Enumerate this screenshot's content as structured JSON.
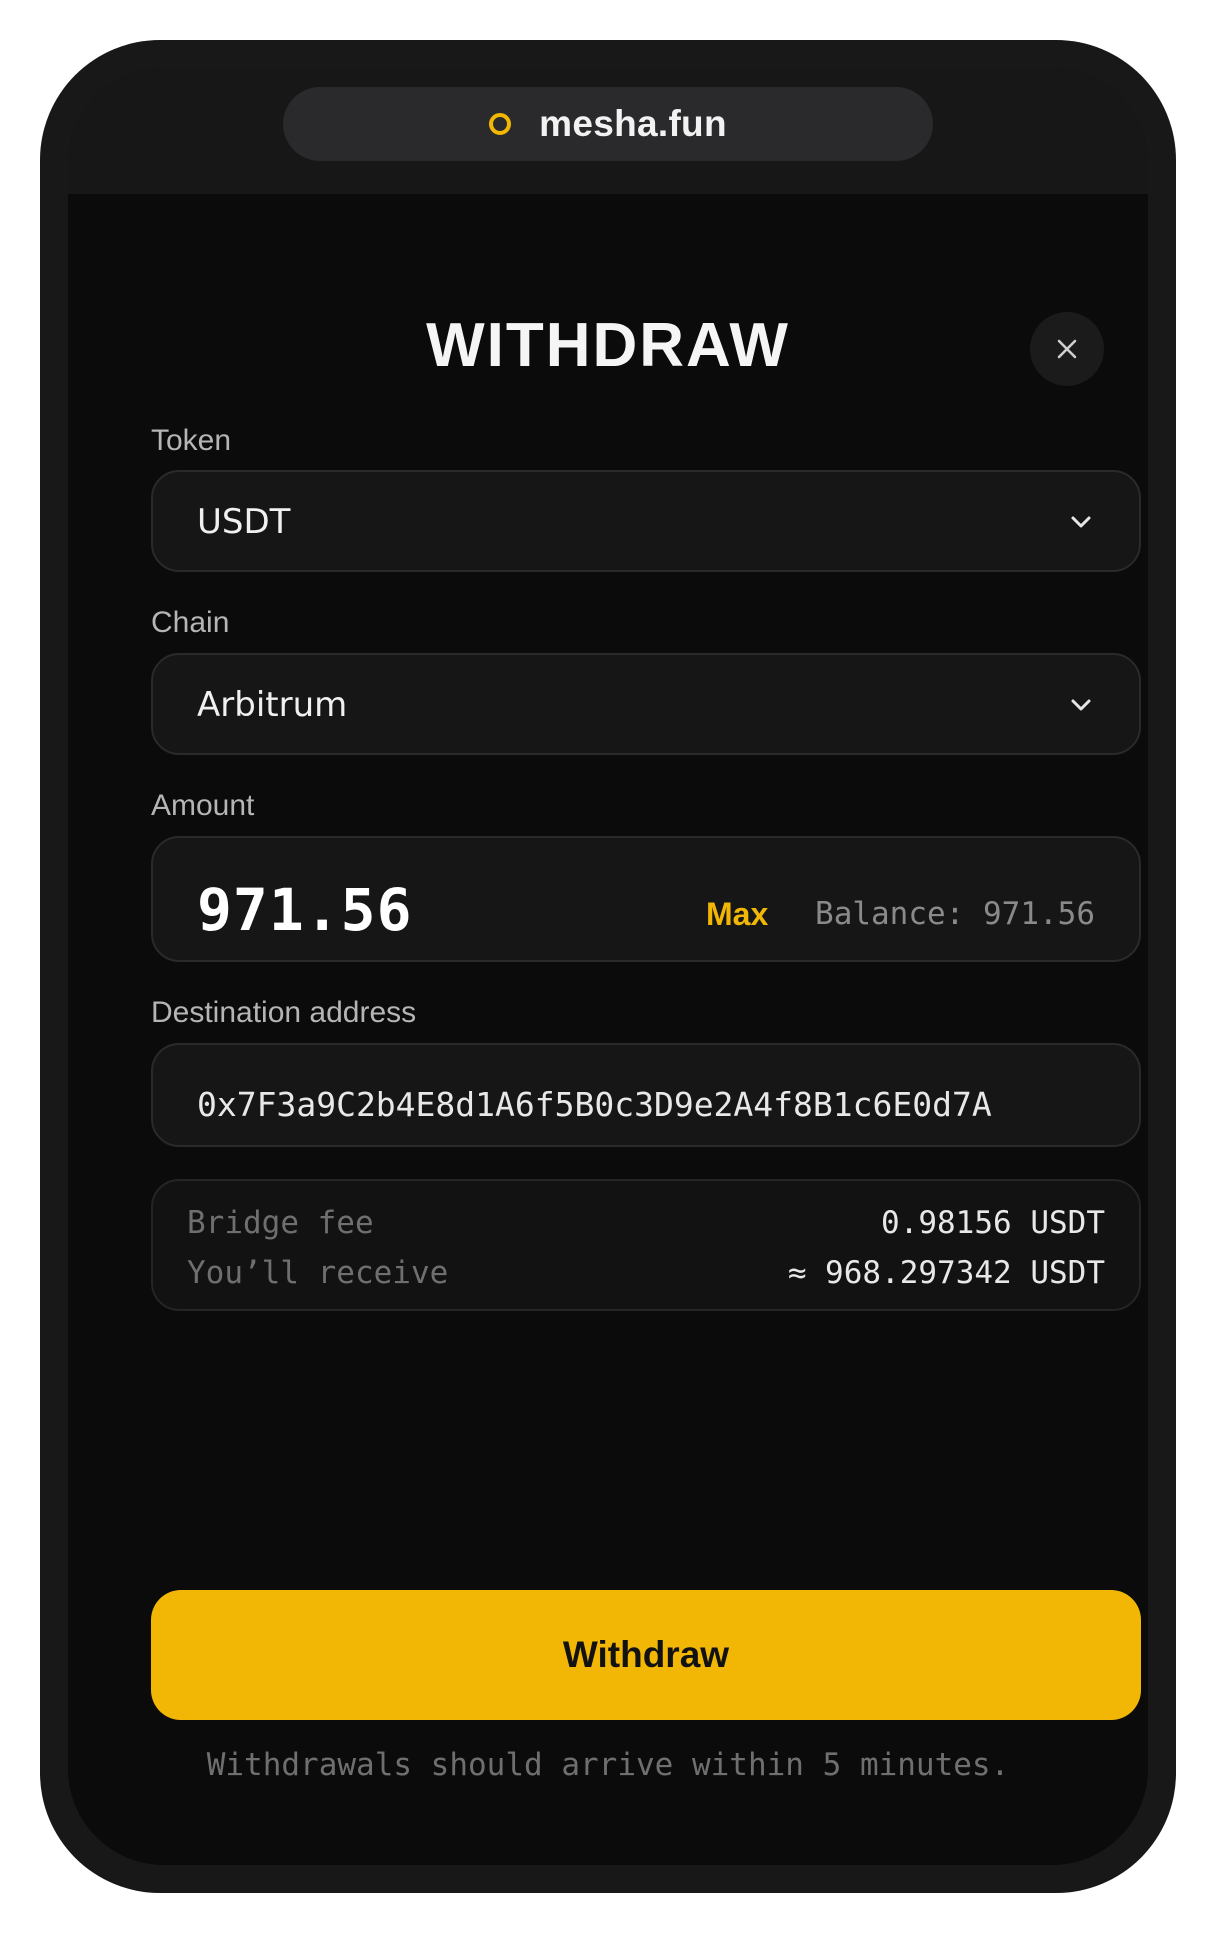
{
  "browser": {
    "url": "mesha.fun"
  },
  "dialog": {
    "title": "WITHDRAW",
    "close_icon": "close-icon"
  },
  "token": {
    "label": "Token",
    "selected": "USDT"
  },
  "chain": {
    "label": "Chain",
    "selected": "Arbitrum"
  },
  "amount": {
    "label": "Amount",
    "value": "971.56",
    "max_label": "Max",
    "balance": "Balance: 971.56"
  },
  "destination": {
    "label": "Destination address",
    "value": "0x7F3a9C2b4E8d1A6f5B0c3D9e2A4f8B1c6E0d7A"
  },
  "summary": {
    "fee_label": "Bridge fee",
    "fee_value": "0.98156 USDT",
    "receive_label": "You’ll receive",
    "receive_value": "≈ 968.297342 USDT"
  },
  "actions": {
    "withdraw_label": "Withdraw"
  },
  "footer": {
    "note": "Withdrawals should arrive within 5 minutes."
  },
  "colors": {
    "accent": "#f2b705",
    "background": "#0b0b0b",
    "field": "#161617"
  }
}
